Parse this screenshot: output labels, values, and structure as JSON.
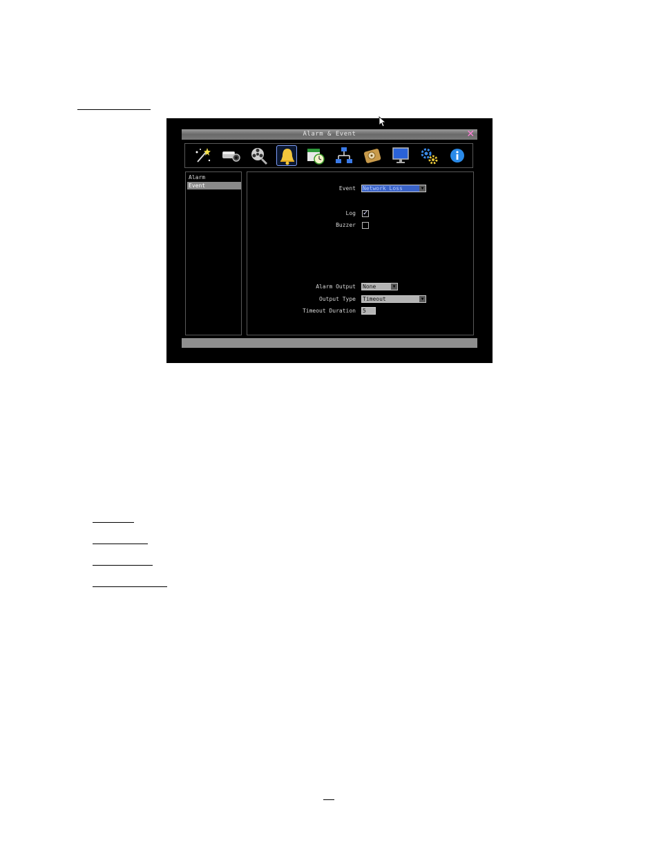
{
  "window": {
    "title": "Alarm & Event",
    "close_label": "✕"
  },
  "toolbar_icons": [
    "wizard-icon",
    "camera-icon",
    "playback-reel-icon",
    "alarm-bell-icon",
    "schedule-icon",
    "network-icon",
    "disk-icon",
    "display-icon",
    "system-settings-icon",
    "info-icon"
  ],
  "selected_icon": "alarm-bell-icon",
  "sidebar": {
    "items": [
      {
        "label": "Alarm",
        "selected": false
      },
      {
        "label": "Event",
        "selected": true
      }
    ]
  },
  "form": {
    "event_label": "Event",
    "event_value": "Network Loss",
    "log_label": "Log",
    "log_checked": true,
    "buzzer_label": "Buzzer",
    "buzzer_checked": false,
    "alarm_output_label": "Alarm Output",
    "alarm_output_value": "None",
    "output_type_label": "Output Type",
    "output_type_value": "Timeout",
    "timeout_duration_label": "Timeout Duration",
    "timeout_duration_value": "5"
  },
  "colors": {
    "selected_dropdown": "#3a63c8",
    "close_icon": "#ff7fd6",
    "selection_highlight": "#8a8a8a"
  }
}
